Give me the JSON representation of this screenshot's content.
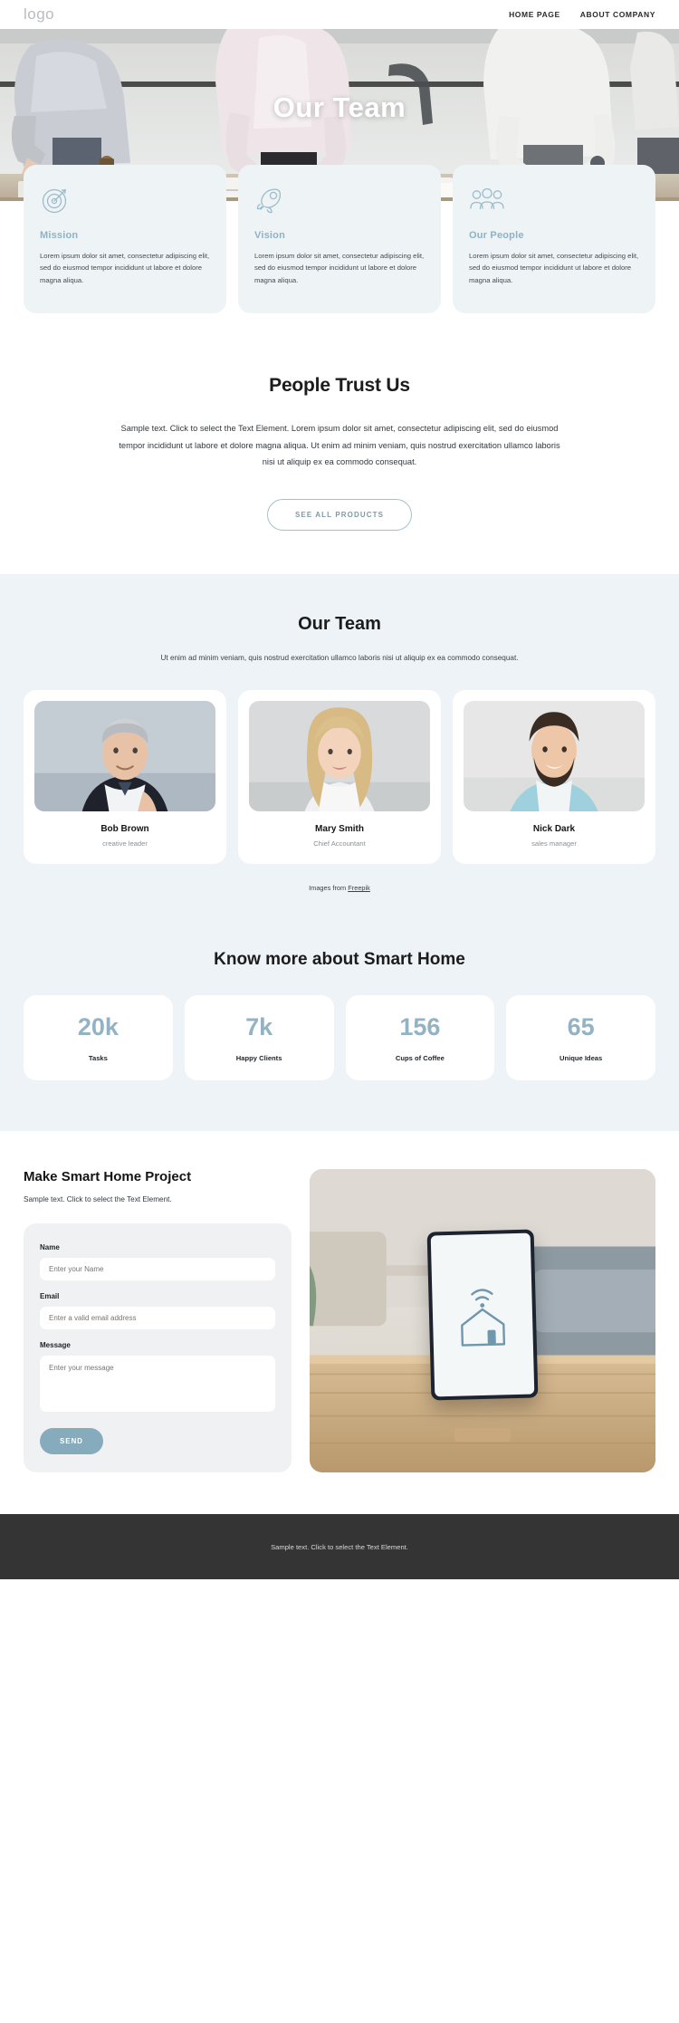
{
  "header": {
    "logo": "logo",
    "nav": [
      {
        "label": "HOME PAGE"
      },
      {
        "label": "ABOUT COMPANY"
      }
    ]
  },
  "hero": {
    "title": "Our Team"
  },
  "features": [
    {
      "icon": "target-icon",
      "title": "Mission",
      "text": "Lorem ipsum dolor sit amet, consectetur adipiscing elit, sed do eiusmod tempor incididunt ut labore et dolore magna aliqua."
    },
    {
      "icon": "rocket-icon",
      "title": "Vision",
      "text": "Lorem ipsum dolor sit amet, consectetur adipiscing elit, sed do eiusmod tempor incididunt ut labore et dolore magna aliqua."
    },
    {
      "icon": "people-group-icon",
      "title": "Our People",
      "text": "Lorem ipsum dolor sit amet, consectetur adipiscing elit, sed do eiusmod tempor incididunt ut labore et dolore magna aliqua."
    }
  ],
  "trust": {
    "heading": "People Trust Us",
    "paragraph": "Sample text. Click to select the Text Element. Lorem ipsum dolor sit amet, consectetur adipiscing elit, sed do eiusmod tempor incididunt ut labore et dolore magna aliqua. Ut enim ad minim veniam, quis nostrud exercitation ullamco laboris nisi ut aliquip ex ea commodo consequat.",
    "button": "SEE ALL PRODUCTS"
  },
  "team": {
    "heading": "Our Team",
    "subtitle": "Ut enim ad minim veniam, quis nostrud exercitation ullamco laboris nisi ut aliquip ex ea commodo consequat.",
    "members": [
      {
        "name": "Bob Brown",
        "role": "creative leader"
      },
      {
        "name": "Mary Smith",
        "role": "Chief Accountant"
      },
      {
        "name": "Nick Dark",
        "role": "sales manager"
      }
    ],
    "credit_prefix": "Images from ",
    "credit_link": "Freepik"
  },
  "stats": {
    "heading": "Know more about Smart Home",
    "items": [
      {
        "value": "20k",
        "label": "Tasks"
      },
      {
        "value": "7k",
        "label": "Happy Clients"
      },
      {
        "value": "156",
        "label": "Cups of Coffee"
      },
      {
        "value": "65",
        "label": "Unique Ideas"
      }
    ]
  },
  "contact": {
    "heading": "Make Smart Home Project",
    "subtitle": "Sample text. Click to select the Text Element.",
    "fields": {
      "name_label": "Name",
      "name_placeholder": "Enter your Name",
      "name_value": "",
      "email_label": "Email",
      "email_placeholder": "Enter a valid email address",
      "email_value": "",
      "message_label": "Message",
      "message_placeholder": "Enter your message",
      "message_value": ""
    },
    "send_button": "SEND"
  },
  "footer": {
    "text": "Sample text. Click to select the Text Element."
  },
  "colors": {
    "accent": "#93b3c4",
    "card_bg": "#eef3f5",
    "section_bg": "#eef3f7",
    "footer_bg": "#343434",
    "send_button": "#86abbd"
  }
}
